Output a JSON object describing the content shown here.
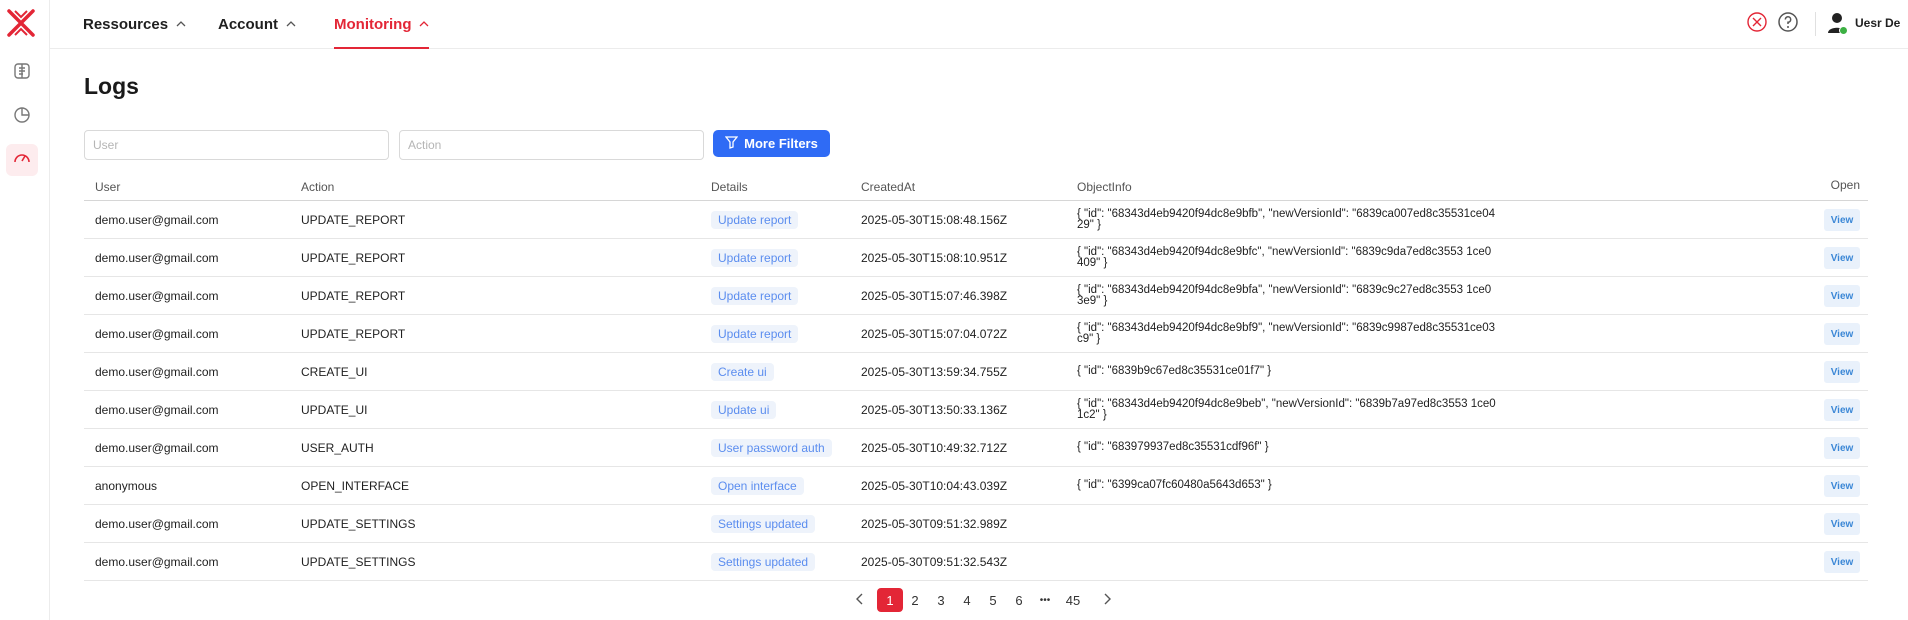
{
  "nav": {
    "items": [
      {
        "label": "Ressources"
      },
      {
        "label": "Account"
      },
      {
        "label": "Monitoring"
      }
    ]
  },
  "user": {
    "name": "Uesr De"
  },
  "page": {
    "title": "Logs"
  },
  "filters": {
    "user_placeholder": "User",
    "action_placeholder": "Action",
    "more_label": "More Filters"
  },
  "table": {
    "headers": {
      "user": "User",
      "action": "Action",
      "details": "Details",
      "created": "CreatedAt",
      "object": "ObjectInfo",
      "open": "Open"
    },
    "view_label": "View",
    "rows": [
      {
        "user": "demo.user@gmail.com",
        "action": "UPDATE_REPORT",
        "details": "Update report",
        "created": "2025-05-30T15:08:48.156Z",
        "object": "{ \"id\": \"68343d4eb9420f94dc8e9bfb\", \"newVersionId\": \"6839ca007ed8c35531ce0429\" }"
      },
      {
        "user": "demo.user@gmail.com",
        "action": "UPDATE_REPORT",
        "details": "Update report",
        "created": "2025-05-30T15:08:10.951Z",
        "object": "{ \"id\": \"68343d4eb9420f94dc8e9bfc\", \"newVersionId\": \"6839c9da7ed8c3553 1ce0409\" }"
      },
      {
        "user": "demo.user@gmail.com",
        "action": "UPDATE_REPORT",
        "details": "Update report",
        "created": "2025-05-30T15:07:46.398Z",
        "object": "{ \"id\": \"68343d4eb9420f94dc8e9bfa\", \"newVersionId\": \"6839c9c27ed8c3553 1ce03e9\" }"
      },
      {
        "user": "demo.user@gmail.com",
        "action": "UPDATE_REPORT",
        "details": "Update report",
        "created": "2025-05-30T15:07:04.072Z",
        "object": "{ \"id\": \"68343d4eb9420f94dc8e9bf9\", \"newVersionId\": \"6839c9987ed8c35531ce03c9\" }"
      },
      {
        "user": "demo.user@gmail.com",
        "action": "CREATE_UI",
        "details": "Create ui",
        "created": "2025-05-30T13:59:34.755Z",
        "object": "{ \"id\": \"6839b9c67ed8c35531ce01f7\" }"
      },
      {
        "user": "demo.user@gmail.com",
        "action": "UPDATE_UI",
        "details": "Update ui",
        "created": "2025-05-30T13:50:33.136Z",
        "object": "{ \"id\": \"68343d4eb9420f94dc8e9beb\", \"newVersionId\": \"6839b7a97ed8c3553 1ce01c2\" }"
      },
      {
        "user": "demo.user@gmail.com",
        "action": "USER_AUTH",
        "details": "User password auth",
        "created": "2025-05-30T10:49:32.712Z",
        "object": "{ \"id\": \"683979937ed8c35531cdf96f\" }"
      },
      {
        "user": "anonymous",
        "action": "OPEN_INTERFACE",
        "details": "Open interface",
        "created": "2025-05-30T10:04:43.039Z",
        "object": "{ \"id\": \"6399ca07fc60480a5643d653\" }"
      },
      {
        "user": "demo.user@gmail.com",
        "action": "UPDATE_SETTINGS",
        "details": "Settings updated",
        "created": "2025-05-30T09:51:32.989Z",
        "object": ""
      },
      {
        "user": "demo.user@gmail.com",
        "action": "UPDATE_SETTINGS",
        "details": "Settings updated",
        "created": "2025-05-30T09:51:32.543Z",
        "object": ""
      }
    ]
  },
  "pagination": {
    "pages": [
      "1",
      "2",
      "3",
      "4",
      "5",
      "6"
    ],
    "ellipsis": "•••",
    "last": "45",
    "current": "1"
  },
  "colors": {
    "accent": "#e32636",
    "primary_button": "#2f6bf5",
    "tag_text": "#5b8def"
  },
  "icons": {
    "logo": "x-logo-icon",
    "sidebar": [
      "brain-icon",
      "pie-chart-icon",
      "gauge-icon"
    ],
    "top_right": [
      "logo-badge-icon",
      "help-icon",
      "user-icon"
    ]
  }
}
